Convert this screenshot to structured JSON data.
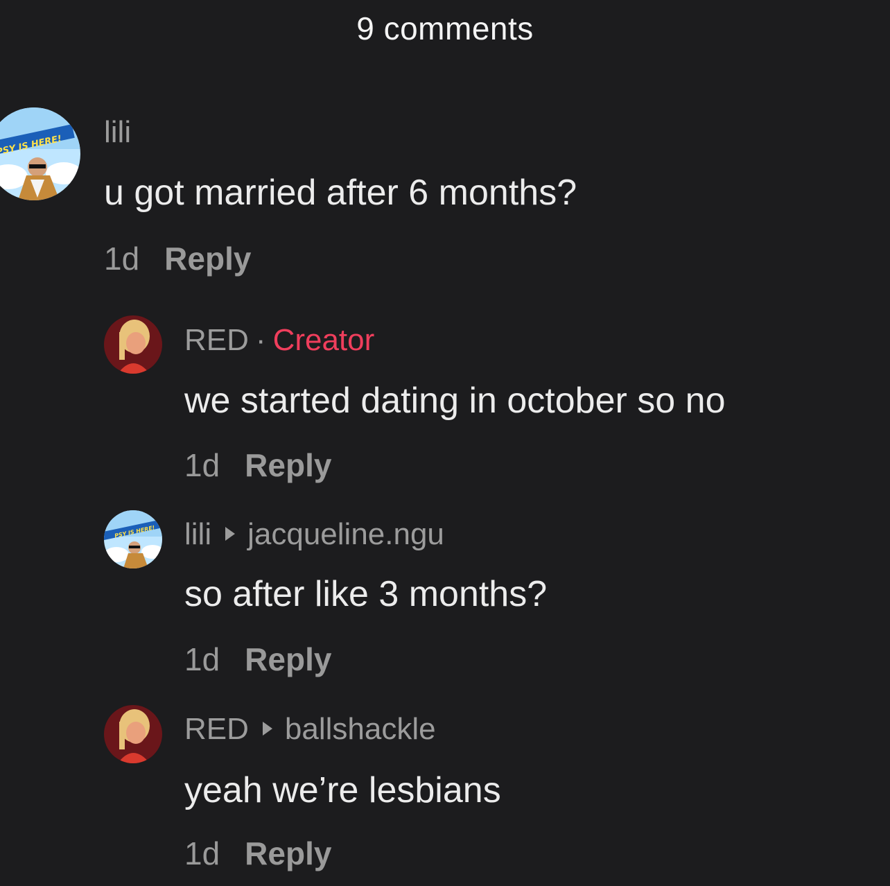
{
  "header": {
    "title": "9 comments"
  },
  "comments": [
    {
      "username": "lili",
      "text": "u got married after 6 months?",
      "time": "1d",
      "reply_label": "Reply",
      "avatar": "lili-avatar"
    },
    {
      "username": "RED",
      "badge_separator": "·",
      "badge": "Creator",
      "text": "we started dating in october so no",
      "time": "1d",
      "reply_label": "Reply",
      "avatar": "red-avatar"
    },
    {
      "username": "lili",
      "reply_to": "jacqueline.ngu",
      "text": "so after like 3 months?",
      "time": "1d",
      "reply_label": "Reply",
      "avatar": "lili-avatar"
    },
    {
      "username": "RED",
      "reply_to": "ballshackle",
      "text": "yeah we’re lesbians",
      "time": "1d",
      "reply_label": "Reply",
      "avatar": "red-avatar"
    }
  ],
  "colors": {
    "background": "#1c1c1e",
    "creator_badge": "#ef3e5c",
    "muted_text": "#9c9c9c",
    "primary_text": "#ececec"
  }
}
